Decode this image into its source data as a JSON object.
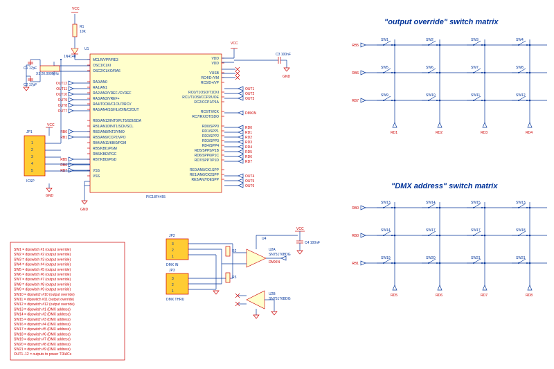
{
  "titles": {
    "override": "\"output override\" switch matrix",
    "dmx": "\"DMX address\" switch matrix"
  },
  "ic": {
    "name": "PIC18F4455",
    "left": [
      "MCLR/VPP/RE3",
      "OSC1/CLKI",
      "OSC2/CLKO/RA6",
      "",
      "RA0/AN0",
      "RA1/AN1",
      "RA2/AN2/VREF-/CVREF",
      "RA3/AN3/VREF+",
      "RA4/T0CKI/C1OUT/RCV",
      "RA5/AN4/SS/HLVDIN/C2OUT",
      "",
      "RB0/AN12/INT0/FLT0/SDI/SDA",
      "RB1/AN10/INT1/SCK/SCL",
      "RB2/AN8/INT2/VMO",
      "RB3/AN9/CCP2/VPO",
      "RB4/AN11/KBI0/PGM",
      "RB5/KBI1/PGM",
      "RB6/KBI2/PGC",
      "RB7/KBI3/PGD",
      "",
      "VSS",
      "VSS"
    ],
    "right": [
      "VDD",
      "VDD",
      "",
      "VUSB",
      "RC4/D-/VM",
      "RC5/D+/VP",
      "",
      "RC0/T1OSO/T1CKI",
      "RC1/T1OSI/CCP2/UOE",
      "RC2/CCP1/P1A",
      "",
      "RC6/TX/CK",
      "RC7/RX/DT/SDO",
      "",
      "RD0/SPP0",
      "RD1/SPP1",
      "RD2/SPP2",
      "RD3/SPP3",
      "RD4/SPP4",
      "RD5/SPP5/P1B",
      "RD6/SPP6/P1C",
      "RD7/SPP7/P1D",
      "",
      "RE0/AN5/CK1SPP",
      "RE1/AN6/CK2SPP",
      "RE2/AN7/OESPP"
    ]
  },
  "leftNets": {
    "outs": [
      "OUT12",
      "OUT11",
      "OUT10",
      "OUT9",
      "OUT8",
      "OUT7"
    ],
    "rb": [
      "RB0",
      "RB1",
      "",
      "",
      "",
      "RB5",
      "RB6",
      "RB7"
    ]
  },
  "rightNets": {
    "top": [
      "OUT1",
      "OUT2",
      "OUT3"
    ],
    "mid": [
      "DMXIN"
    ],
    "rd": [
      "RD0",
      "RD1",
      "RD2",
      "RD3",
      "RD4",
      "RD5",
      "RD6",
      "RD7"
    ],
    "re": [
      "OUT4",
      "OUT5",
      "OUT6"
    ]
  },
  "parts": {
    "r1": "R1",
    "r1v": "10K",
    "d1": "1N4148",
    "c1": "C1 17pF",
    "c2": "C2 17pF",
    "x1": "X1 20.000MHz",
    "c3": "C3 100nF",
    "vcc": "VCC",
    "gnd": "GND",
    "u1": "U1",
    "u4": "U4",
    "c4": "C4 100nF"
  },
  "jp1": {
    "name": "JP1",
    "sub": "ICSP",
    "pins": [
      "1",
      "2",
      "3",
      "4",
      "5"
    ]
  },
  "jp2": {
    "name": "JP2",
    "sub": "DMX IN",
    "pins": [
      "3",
      "2",
      "1"
    ]
  },
  "jp3": {
    "name": "JP3",
    "sub": "DMX THRU",
    "pins": [
      "3",
      "2",
      "1"
    ]
  },
  "amp": {
    "a": "U2A",
    "b": "U2B",
    "part": "SN75176BDG",
    "net": "DMXIN",
    "r2": "R2",
    "r3": "R3"
  },
  "override": {
    "rows": [
      "RB5",
      "RB6",
      "RB7"
    ],
    "cols": [
      "RD1",
      "RD2",
      "RD3",
      "RD4"
    ],
    "sw": [
      [
        "SW1",
        "SW2",
        "SW3",
        "SW4"
      ],
      [
        "SW5",
        "SW6",
        "SW7",
        "SW8"
      ],
      [
        "SW9",
        "SW10",
        "SW11",
        "SW12"
      ]
    ]
  },
  "dmx": {
    "rows": [
      "RB0",
      "RB0",
      "RB1"
    ],
    "cols": [
      "RD5",
      "RD6",
      "RD7",
      "RD8"
    ],
    "sw": [
      [
        "SW13",
        "SW14",
        "SW15",
        "SW13"
      ],
      [
        "SW14",
        "SW17",
        "SW17",
        "SW18"
      ],
      [
        "SW19",
        "SW20",
        "SW21",
        "SW21"
      ]
    ]
  },
  "legend": {
    "title": "",
    "lines": [
      "SW1 = dipswitch #1 (output override)",
      "SW2 = dipswitch #2 (output override)",
      "SW3 = dipswitch #3 (output override)",
      "SW4 = dipswitch #4 (output override)",
      "SW5 = dipswitch #5 (output override)",
      "SW6 = dipswitch #6 (output override)",
      "SW7 = dipswitch #7 (output override)",
      "SW8 = dipswitch #8 (output override)",
      "SW9 = dipswitch #9 (output override)",
      "SW10 = dipswitch #10 (output override)",
      "SW11 = dipswitch #11 (output override)",
      "SW12 = dipswitch #12 (output override)",
      "SW13 = dipswitch #1 (DMX address)",
      "SW14 = dipswitch #2 (DMX address)",
      "SW15 = dipswitch #3 (DMX address)",
      "SW16 = dipswitch #4 (DMX address)",
      "SW17 = dipswitch #5 (DMX address)",
      "SW18 = dipswitch #6 (DMX address)",
      "SW19 = dipswitch #7 (DMX address)",
      "SW20 = dipswitch #8 (DMX address)",
      "SW21 = dipswitch #9 (DMX address)",
      "OUT1..12 = outputs to power TRIACs"
    ]
  },
  "chart_data": {
    "type": "diagram"
  }
}
